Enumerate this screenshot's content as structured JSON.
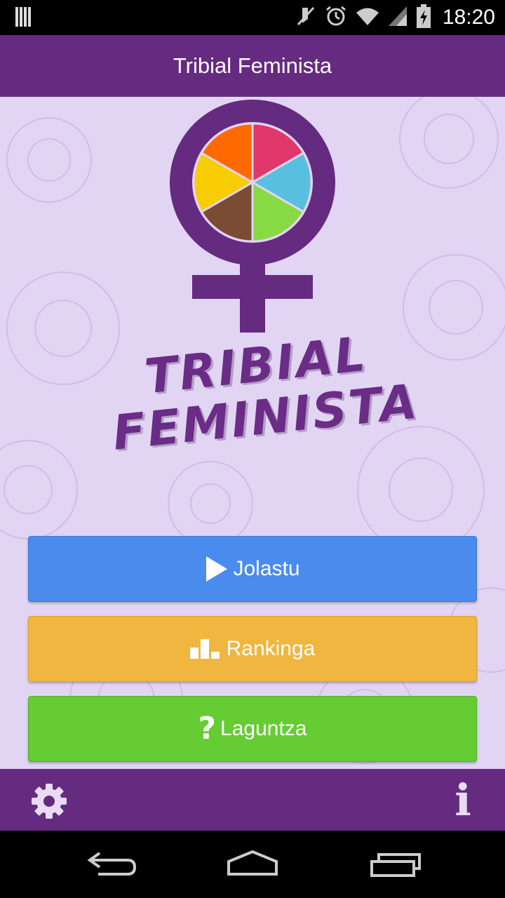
{
  "status_bar": {
    "time": "18:20"
  },
  "app_bar": {
    "title": "Tribial Feminista"
  },
  "logo": {
    "line1": "TRIBIAL",
    "line2": "FEMINISTA",
    "wedge_colors": [
      "#e0386a",
      "#58bfe0",
      "#88da44",
      "#7a4c34",
      "#f7cc00",
      "#ff6a00"
    ]
  },
  "menu": {
    "play_label": "Jolastu",
    "ranking_label": "Rankinga",
    "help_label": "Laguntza",
    "help_glyph": "?"
  },
  "bottom_bar": {
    "info_glyph": "i"
  },
  "colors": {
    "primary": "#652b80",
    "background": "#e2d5f3",
    "play": "#4a8bee",
    "ranking": "#f1b63f",
    "help": "#66cc33"
  }
}
